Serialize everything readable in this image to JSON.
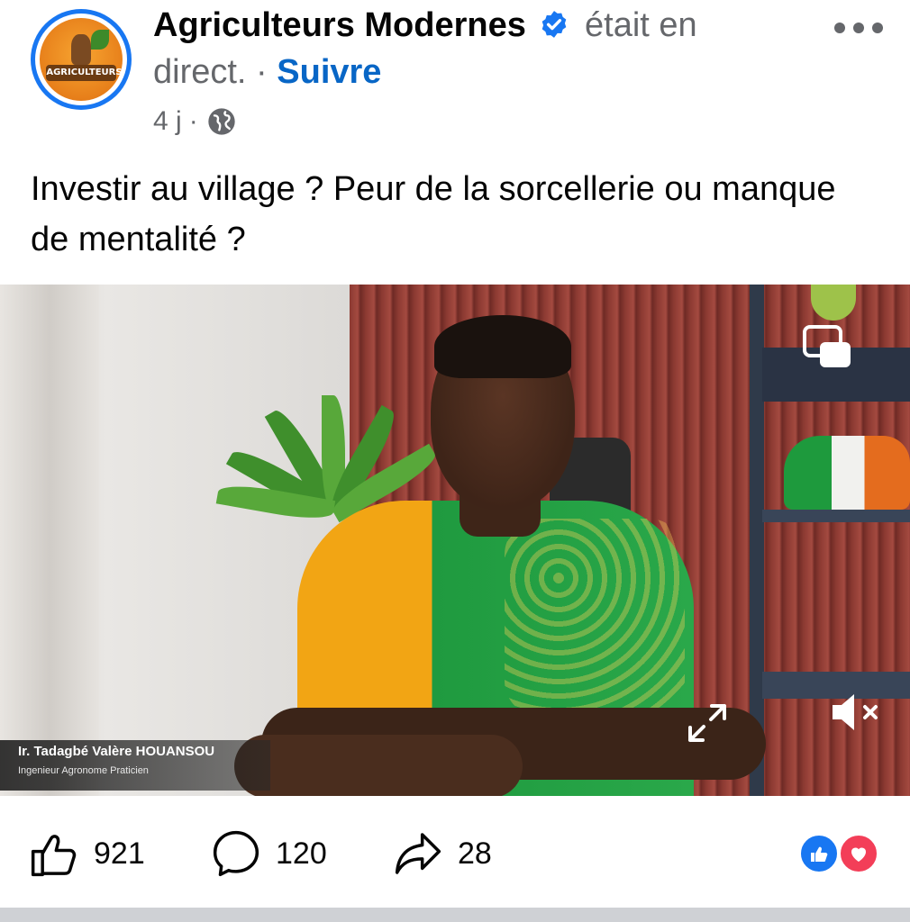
{
  "post": {
    "page_name": "Agriculteurs Modernes",
    "status_a": "était en",
    "status_b": "direct.",
    "separator": "·",
    "follow_label": "Suivre",
    "time": "4 j",
    "time_separator": "·",
    "audience_icon": "globe-icon",
    "text": "Investir au village ? Peur de la sorcellerie ou manque de mentalité ?"
  },
  "video": {
    "speaker_name": "Ir. Tadagbé Valère HOUANSOU",
    "speaker_title": "Ingenieur Agronome Praticien",
    "controls": [
      "picture-in-picture-icon",
      "expand-icon",
      "mute-icon"
    ]
  },
  "actions": {
    "like_count": "921",
    "comment_count": "120",
    "share_count": "28"
  },
  "avatar": {
    "logo_text": "AGRICULTEURS"
  },
  "colors": {
    "brand_blue": "#1877f2",
    "follow_blue": "#0866c6",
    "love_red": "#f33e58",
    "secondary_text": "#65676b"
  }
}
